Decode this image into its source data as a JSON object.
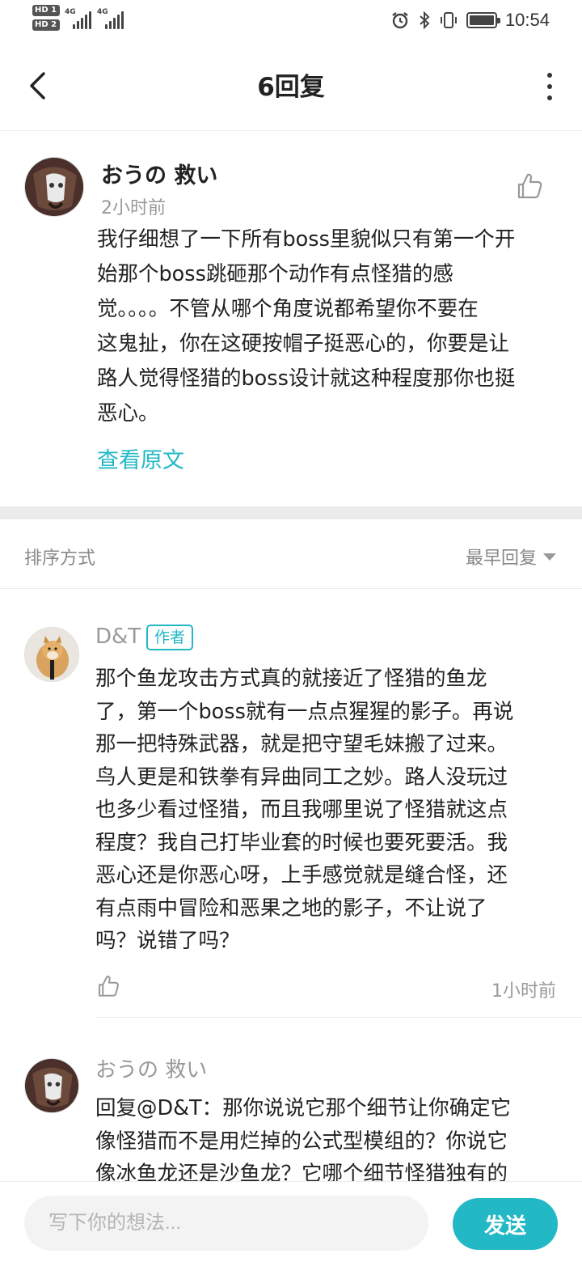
{
  "status_bar": {
    "sim1": "HD 1",
    "sim2": "HD 2",
    "net1": "4G",
    "net2": "4G",
    "time": "10:54",
    "icons": [
      "alarm-icon",
      "bluetooth-icon",
      "vibrate-icon",
      "battery-icon"
    ]
  },
  "header": {
    "title": "6回复",
    "icons": [
      "back-arrow-icon",
      "more-vertical-icon"
    ]
  },
  "main_comment": {
    "author": "おうの 救い",
    "time": "2小时前",
    "body": "我仔细想了一下所有boss里貌似只有第一个开\n始那个boss跳砸那个动作有点怪猎的感\n觉。。。。不管从哪个角度说都希望你不要在\n这鬼扯，你在这硬按帽子挺恶心的，你要是让\n路人觉得怪猎的boss设计就这种程度那你也挺\n恶心。",
    "view_original": "查看原文"
  },
  "sort": {
    "label": "排序方式",
    "selected": "最早回复"
  },
  "replies": [
    {
      "author": "D&T",
      "badge": "作者",
      "body": "那个鱼龙攻击方式真的就接近了怪猎的鱼龙\n了，第一个boss就有一点点猩猩的影子。再说\n那一把特殊武器，就是把守望毛妹搬了过来。\n鸟人更是和铁拳有异曲同工之妙。路人没玩过\n也多少看过怪猎，而且我哪里说了怪猎就这点\n程度？我自己打毕业套的时候也要死要活。我\n恶心还是你恶心呀，上手感觉就是缝合怪，还\n有点雨中冒险和恶果之地的影子，不让说了\n吗？说错了吗？",
      "time": "1小时前"
    },
    {
      "author": "おうの 救い",
      "body": "回复@D&T：那你说说它那个细节让你确定它\n像怪猎而不是用烂掉的公式型模组的？你说它\n像冰鱼龙还是沙鱼龙？它哪个细节怪猎独有的"
    }
  ],
  "input_bar": {
    "placeholder": "写下你的想法...",
    "send_label": "发送"
  },
  "colors": {
    "accent": "#23b8c6",
    "muted_text": "#999999",
    "divider": "#ebebeb"
  }
}
